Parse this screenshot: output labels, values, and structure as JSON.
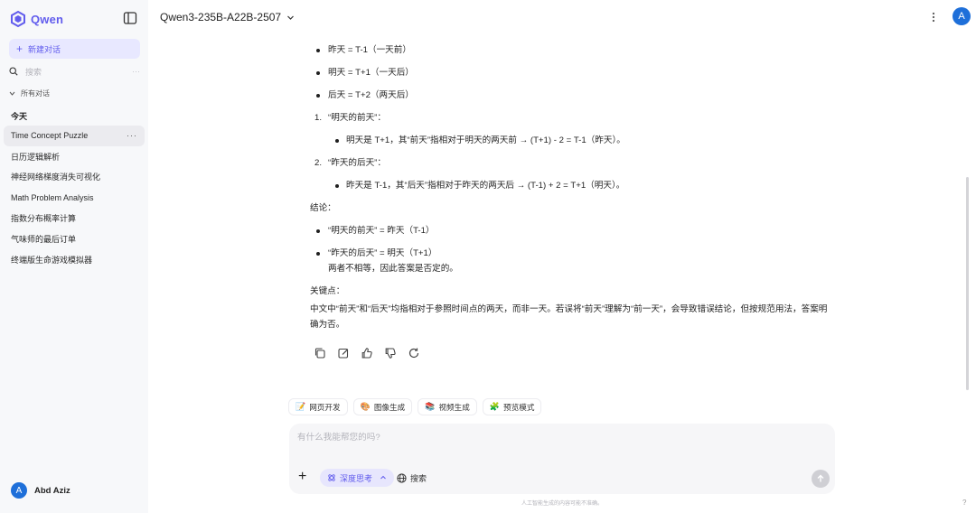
{
  "sidebar": {
    "brand": "Qwen",
    "new_chat": "新建对话",
    "search_placeholder": "搜索",
    "search_more": "···",
    "all_chats": "所有对话",
    "group_today": "今天",
    "conversations": [
      {
        "title": "Time Concept Puzzle",
        "more": "···"
      },
      {
        "title": "日历逻辑解析"
      },
      {
        "title": "神经网络梯度消失可视化"
      },
      {
        "title": "Math Problem Analysis"
      },
      {
        "title": "指数分布概率计算"
      },
      {
        "title": "气味师的最后订单"
      },
      {
        "title": "终端版生命游戏模拟器"
      }
    ],
    "user": {
      "initial": "A",
      "name": "Abd Aziz"
    }
  },
  "header": {
    "model": "Qwen3-235B-A22B-2507",
    "avatar_initial": "A"
  },
  "message": {
    "top_bullets": [
      "昨天 = T-1（一天前）",
      "明天 = T+1（一天后）",
      "后天 = T+2（两天后）"
    ],
    "steps": [
      {
        "num": "1.",
        "title": "“明天的前天”：",
        "detail": "明天是 T+1，其“前天”指相对于明天的两天前 → (T+1) - 2 = T-1（昨天）。"
      },
      {
        "num": "2.",
        "title": "“昨天的后天”：",
        "detail": "昨天是 T-1，其“后天”指相对于昨天的两天后 → (T-1) + 2 = T+1（明天）。"
      }
    ],
    "conclusion_label": "结论：",
    "conclusion_bullets": [
      "“明天的前天” = 昨天（T-1）",
      "“昨天的后天” = 明天（T+1）"
    ],
    "conclusion_tail": "两者不相等，因此答案是否定的。",
    "keypoint_label": "关键点：",
    "keypoint_text": "中文中“前天”和“后天”均指相对于参照时间点的两天，而非一天。若误将“前天”理解为“前一天”，会导致错误结论，但按规范用法，答案明确为否。"
  },
  "chips": [
    {
      "emoji": "📝",
      "label": "网页开发"
    },
    {
      "emoji": "🎨",
      "label": "图像生成"
    },
    {
      "emoji": "📚",
      "label": "视频生成"
    },
    {
      "emoji": "🧩",
      "label": "预览模式"
    }
  ],
  "composer": {
    "placeholder": "有什么我能帮您的吗?",
    "add": "+",
    "think_label": "深度思考",
    "search_label": "搜索"
  },
  "footer": {
    "disclaimer": "人工智能生成的内容可能不准确。",
    "help": "?"
  },
  "colors": {
    "accent": "#615ced",
    "avatar": "#1e6fd9"
  }
}
